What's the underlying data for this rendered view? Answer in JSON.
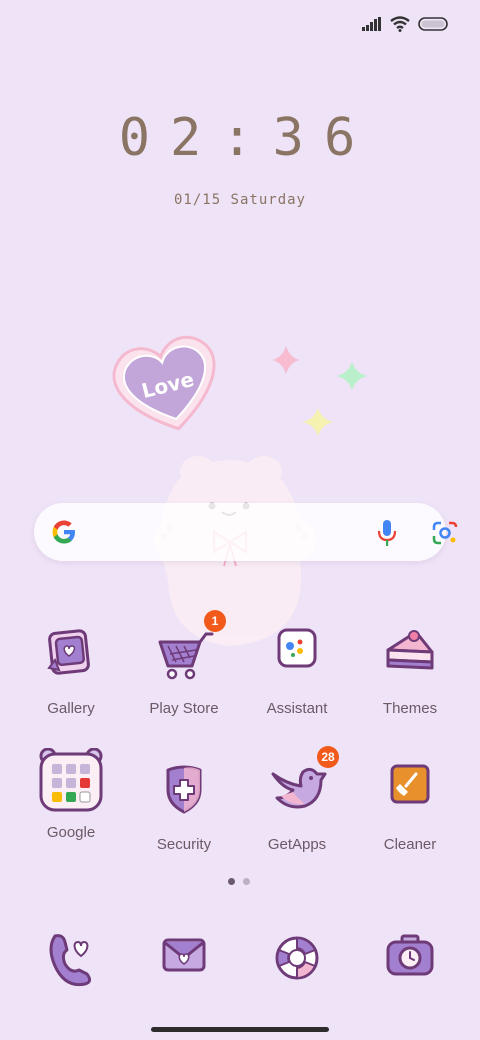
{
  "status_bar": {
    "icons": [
      "signal-icon",
      "wifi-icon",
      "battery-icon"
    ]
  },
  "clock": {
    "time": "02:36",
    "date": "01/15 Saturday"
  },
  "wallpaper": {
    "heart_text": "Love"
  },
  "search": {
    "icons": [
      "google-g-icon",
      "microphone-icon",
      "lens-icon"
    ]
  },
  "apps": [
    {
      "label": "Gallery",
      "icon": "gallery-icon",
      "badge": ""
    },
    {
      "label": "Play Store",
      "icon": "shopping-cart-icon",
      "badge": "1"
    },
    {
      "label": "Assistant",
      "icon": "assistant-icon",
      "badge": ""
    },
    {
      "label": "Themes",
      "icon": "cake-icon",
      "badge": ""
    },
    {
      "label": "Google",
      "icon": "google-folder-icon",
      "badge": ""
    },
    {
      "label": "Security",
      "icon": "shield-icon",
      "badge": ""
    },
    {
      "label": "GetApps",
      "icon": "bird-icon",
      "badge": "28"
    },
    {
      "label": "Cleaner",
      "icon": "broom-icon",
      "badge": ""
    }
  ],
  "page_indicator": {
    "count": 2,
    "active": 1
  },
  "dock": [
    {
      "icon": "phone-icon"
    },
    {
      "icon": "messages-icon"
    },
    {
      "icon": "browser-icon"
    },
    {
      "icon": "camera-icon"
    }
  ],
  "colors": {
    "background": "#efe3f7",
    "accent": "#8d6bb5",
    "badge": "#f25a1c",
    "text": "#6c5a66"
  }
}
